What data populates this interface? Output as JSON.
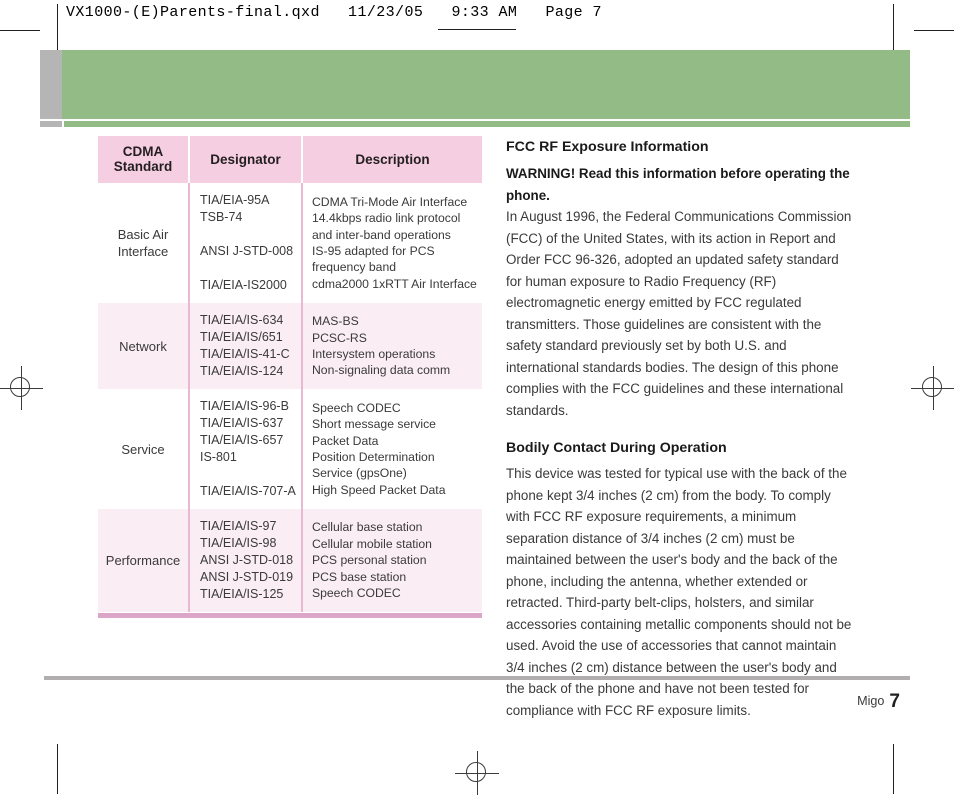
{
  "prepress": {
    "file_slug": "VX1000-(E)Parents-final.qxd   11/23/05   9:33 AM   Page 7"
  },
  "table": {
    "headers": [
      "CDMA\nStandard",
      "Designator",
      "Description"
    ],
    "header_lines": {
      "col1_line1": "CDMA",
      "col1_line2": "Standard",
      "col2": "Designator",
      "col3": "Description"
    },
    "rows": [
      {
        "standard": "Basic Air\nInterface",
        "standard_line1": "Basic Air",
        "standard_line2": "Interface",
        "designators": [
          "TIA/EIA-95A",
          "TSB-74",
          "",
          "ANSI J-STD-008",
          "",
          "TIA/EIA-IS2000"
        ],
        "descriptions": [
          "CDMA Tri-Mode Air Interface",
          "14.4kbps radio link protocol and inter-band operations",
          "IS-95 adapted for PCS frequency band",
          "cdma2000 1xRTT Air Interface"
        ],
        "tint": false
      },
      {
        "standard": "Network",
        "designators": [
          "TIA/EIA/IS-634",
          "TIA/EIA/IS/651",
          "TIA/EIA/IS-41-C",
          "TIA/EIA/IS-124"
        ],
        "descriptions": [
          "MAS-BS",
          "PCSC-RS",
          "Intersystem operations",
          "Non-signaling data comm"
        ],
        "tint": true
      },
      {
        "standard": "Service",
        "designators": [
          "TIA/EIA/IS-96-B",
          "TIA/EIA/IS-637",
          "TIA/EIA/IS-657",
          "IS-801",
          "",
          "TIA/EIA/IS-707-A"
        ],
        "descriptions": [
          "Speech CODEC",
          "Short message service",
          "Packet Data",
          "Position Determination Service (gpsOne)",
          "High Speed Packet Data"
        ],
        "tint": false
      },
      {
        "standard": "Performance",
        "designators": [
          "TIA/EIA/IS-97",
          "TIA/EIA/IS-98",
          "ANSI J-STD-018",
          "ANSI J-STD-019",
          "TIA/EIA/IS-125"
        ],
        "descriptions": [
          "Cellular base station",
          "Cellular mobile station",
          "PCS personal station",
          "PCS base station",
          "Speech CODEC"
        ],
        "tint": true
      }
    ]
  },
  "article": {
    "heading": "FCC RF Exposure Information",
    "warning": "WARNING! Read this information before operating the phone.",
    "paragraph_1": "In August 1996, the Federal Communications Commission (FCC) of the United States, with its action in Report and Order FCC 96-326, adopted an updated safety standard for human exposure to Radio Frequency (RF) electromagnetic energy emitted by FCC regulated transmitters. Those guidelines are consistent with the safety standard previously set by both U.S. and international standards bodies. The design of this phone complies with the FCC guidelines and these international standards.",
    "heading_2": "Bodily Contact During Operation",
    "paragraph_2": "This device was tested for typical use with the back of the phone kept 3/4 inches (2 cm) from the body. To comply with FCC RF exposure requirements, a minimum separation distance of 3/4 inches (2 cm) must be maintained between the user's body and the back of the phone, including the antenna, whether extended or retracted. Third-party belt-clips, holsters, and similar accessories containing metallic components should not be used. Avoid the use of accessories that cannot maintain 3/4 inches (2 cm) distance between the user's body and the back of the phone and have not been tested for compliance with FCC RF exposure limits."
  },
  "footer": {
    "brand": "Migo",
    "page_number": "7"
  },
  "colors": {
    "banner_green": "#93bb86",
    "banner_tab_gray": "#b5b5b5",
    "table_header_pink": "#f6cee2",
    "table_tint_pink": "#faedf4",
    "table_rule_pink": "#dca6c8",
    "footer_rule_gray": "#b0aeae",
    "text_dark": "#231f20"
  }
}
